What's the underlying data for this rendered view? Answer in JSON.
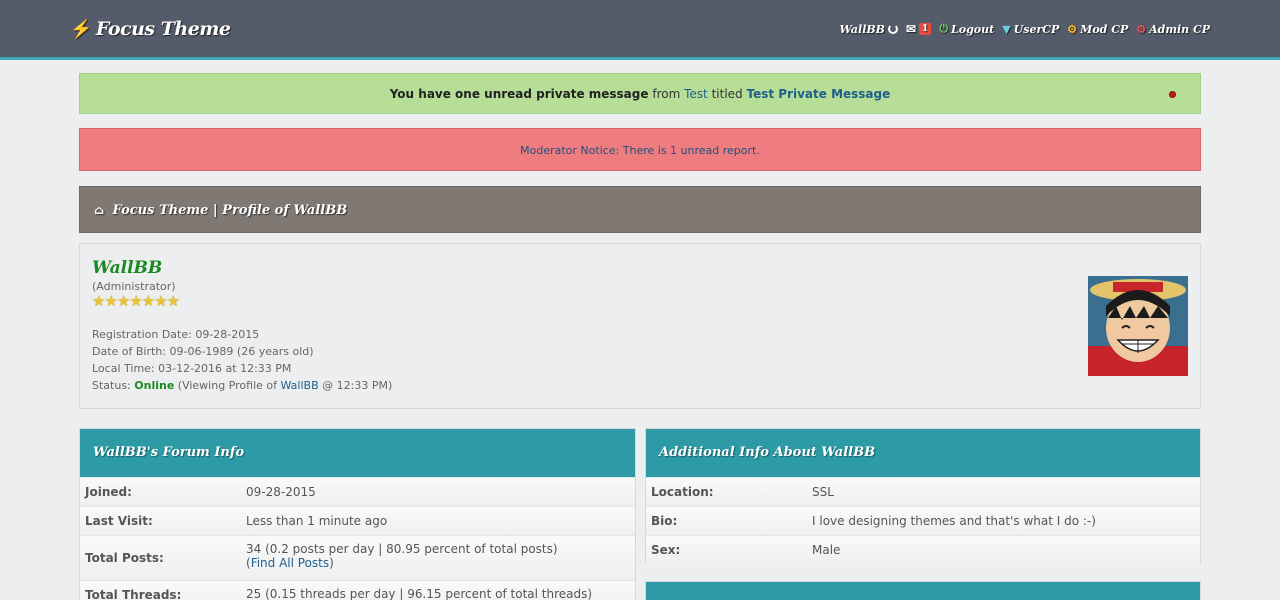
{
  "header": {
    "logo": "Focus Theme",
    "user": "WallBB",
    "pm_count": "1",
    "logout": "Logout",
    "usercp": "UserCP",
    "modcp": "Mod CP",
    "admincp": "Admin CP"
  },
  "pm_alert": {
    "bold": "You have one unread private message",
    "from": "from",
    "sender": "Test",
    "titled": "titled",
    "title": "Test Private Message"
  },
  "mod_notice": "Moderator Notice: There is 1 unread report.",
  "breadcrumb": {
    "home": "Focus Theme",
    "sep": "|",
    "current": "Profile of WallBB"
  },
  "profile": {
    "username": "WallBB",
    "usertitle": "(Administrator)",
    "stars": "★★★★★★★",
    "registration": "Registration Date: 09-28-2015",
    "dob": "Date of Birth: 09-06-1989 (26 years old)",
    "local_time": "Local Time: 03-12-2016 at 12:33 PM",
    "status_label": "Status:",
    "status": "Online",
    "status_detail_pre": "(Viewing Profile of",
    "status_user": "WallBB",
    "status_detail_post": "@ 12:33 PM)"
  },
  "forum_info": {
    "title": "WallBB's Forum Info",
    "rows": [
      {
        "label": "Joined:",
        "value": "09-28-2015"
      },
      {
        "label": "Last Visit:",
        "value": "Less than 1 minute ago"
      },
      {
        "label": "Total Posts:",
        "value": "34 (0.2 posts per day | 80.95 percent of total posts)",
        "link": "Find All Posts"
      },
      {
        "label": "Total Threads:",
        "value": "25 (0.15 threads per day | 96.15 percent of total threads)"
      }
    ]
  },
  "additional_info": {
    "title": "Additional Info About WallBB",
    "rows": [
      {
        "label": "Location:",
        "value": "SSL"
      },
      {
        "label": "Bio:",
        "value": "I love designing themes and that's what I do :-)"
      },
      {
        "label": "Sex:",
        "value": "Male"
      }
    ]
  }
}
